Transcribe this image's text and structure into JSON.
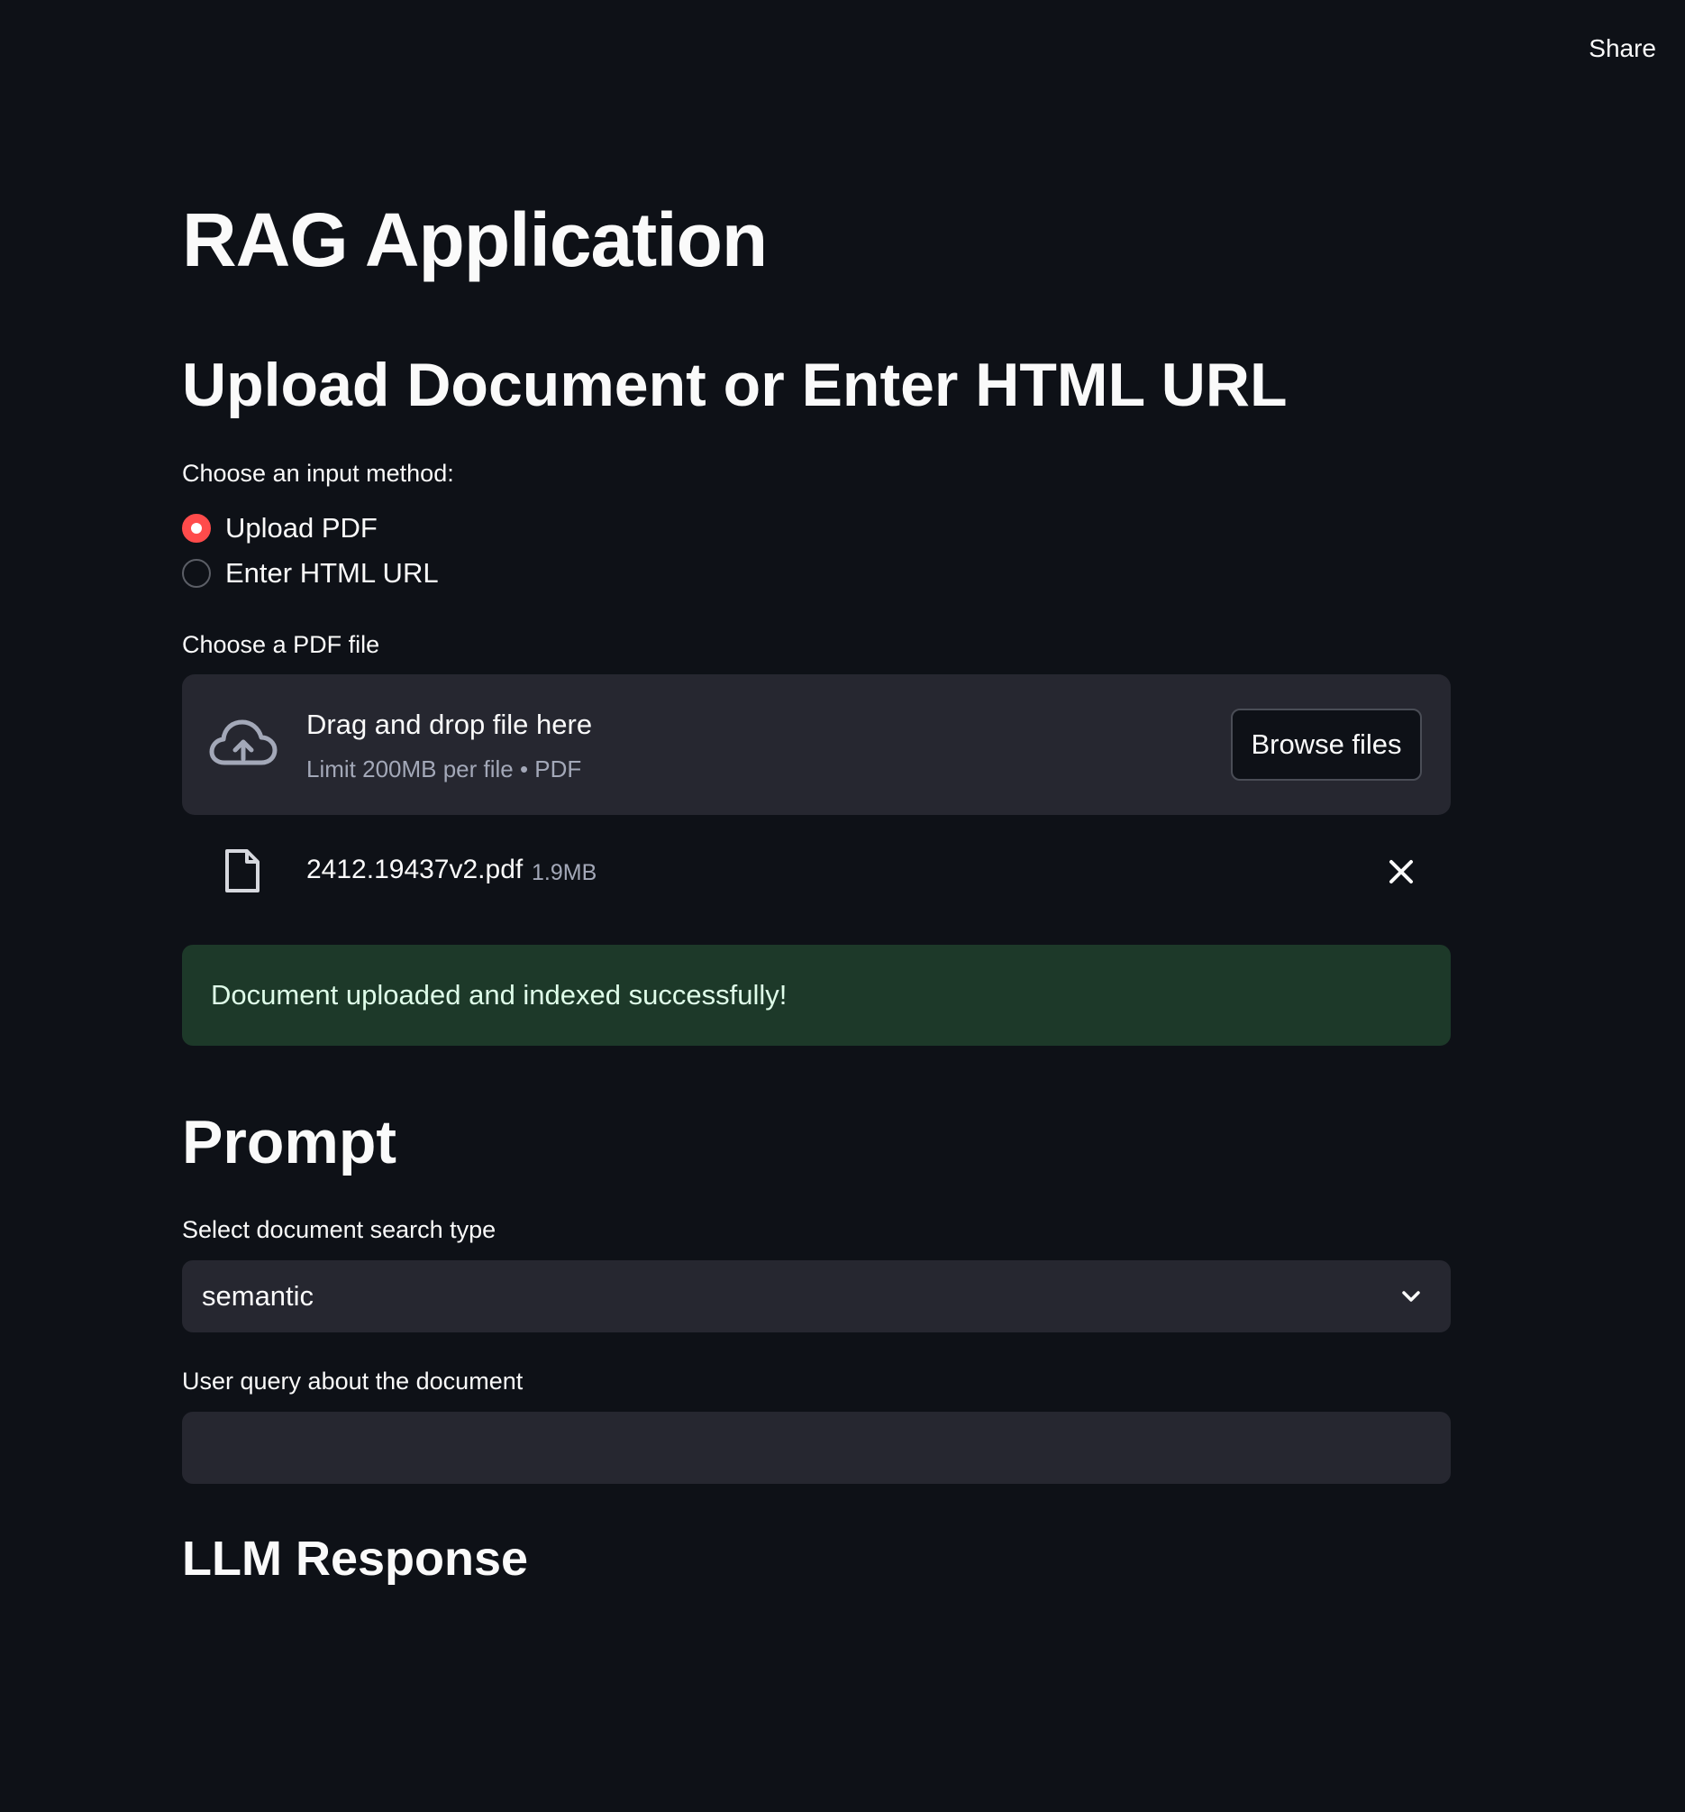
{
  "header": {
    "share_label": "Share"
  },
  "page": {
    "title": "RAG Application",
    "upload_section_heading": "Upload Document or Enter HTML URL"
  },
  "input_method": {
    "label": "Choose an input method:",
    "options": [
      {
        "label": "Upload PDF",
        "selected": true
      },
      {
        "label": "Enter HTML URL",
        "selected": false
      }
    ]
  },
  "uploader": {
    "label": "Choose a PDF file",
    "drop_text": "Drag and drop file here",
    "limit_text": "Limit 200MB per file • PDF",
    "browse_label": "Browse files",
    "icon": "cloud-upload-icon"
  },
  "uploaded_file": {
    "name": "2412.19437v2.pdf",
    "size": "1.9MB",
    "icon": "file-icon"
  },
  "status": {
    "success_message": "Document uploaded and indexed successfully!"
  },
  "prompt": {
    "heading": "Prompt",
    "search_type_label": "Select document search type",
    "search_type_value": "semantic",
    "query_label": "User query about the document",
    "query_value": "",
    "query_placeholder": ""
  },
  "response": {
    "heading": "LLM Response"
  },
  "colors": {
    "background": "#0e1117",
    "surface": "#262730",
    "accent": "#ff4b4b",
    "success_bg": "#1d3929",
    "muted_text": "#a3a8b8"
  }
}
